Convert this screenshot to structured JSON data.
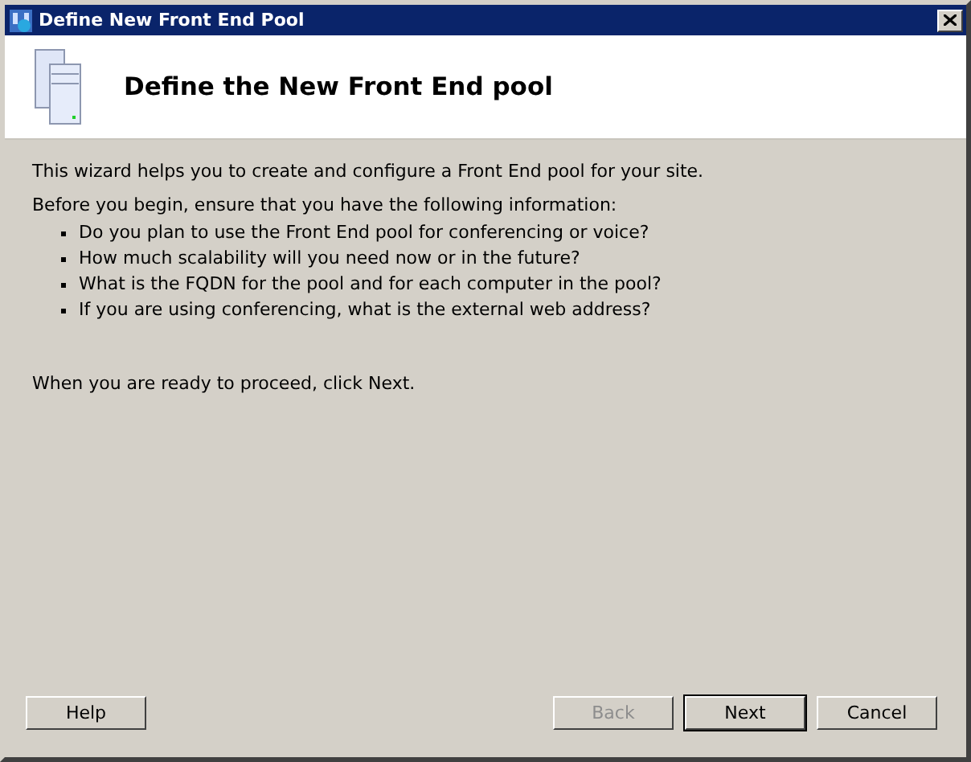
{
  "window": {
    "title": "Define New Front End Pool"
  },
  "header": {
    "title": "Define the New Front End pool"
  },
  "intro": "This wizard helps you to create and configure a Front End pool for your site.",
  "prereq_heading": "Before you begin, ensure that you have the following information:",
  "prereq_items": [
    "Do you plan to use the Front End pool for conferencing or voice?",
    "How much scalability will you need now or in the future?",
    "What is the FQDN for the pool and for each computer in the pool?",
    "If you are using conferencing, what is the external web address?"
  ],
  "closing": "When you are ready to proceed, click Next.",
  "left_buttons": [
    {
      "label": "Help",
      "disabled": false,
      "default": false
    }
  ],
  "right_buttons": [
    {
      "label": "Back",
      "disabled": true,
      "default": false
    },
    {
      "label": "Next",
      "disabled": false,
      "default": true
    },
    {
      "label": "Cancel",
      "disabled": false,
      "default": false
    }
  ]
}
